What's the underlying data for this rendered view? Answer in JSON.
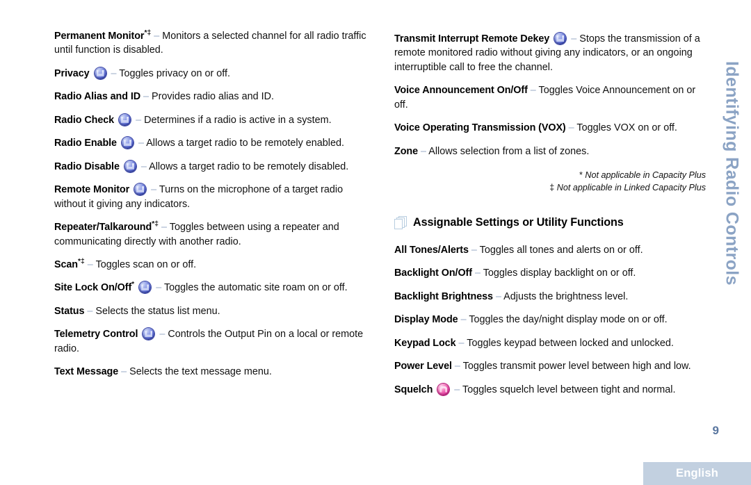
{
  "side_tab": {
    "label": "Identifying Radio Controls"
  },
  "page_number": "9",
  "footer": {
    "language": "English"
  },
  "dash": "–",
  "left_column": {
    "entries": [
      {
        "term": "Permanent Monitor",
        "marks": "*‡",
        "icon": null,
        "desc": "Monitors a selected channel for all radio traffic until function is disabled."
      },
      {
        "term": "Privacy",
        "marks": "",
        "icon": "blue-round-button-icon",
        "desc": "Toggles privacy on or off."
      },
      {
        "term": "Radio Alias and ID",
        "marks": "",
        "icon": null,
        "desc": "Provides radio alias and ID."
      },
      {
        "term": "Radio Check",
        "marks": "",
        "icon": "blue-round-button-icon",
        "desc": "Determines if a radio is active in a system."
      },
      {
        "term": "Radio Enable",
        "marks": "",
        "icon": "blue-round-button-icon",
        "desc": "Allows a target radio to be remotely enabled."
      },
      {
        "term": "Radio Disable",
        "marks": "",
        "icon": "blue-round-button-icon",
        "desc": "Allows a target radio to be remotely disabled."
      },
      {
        "term": "Remote Monitor",
        "marks": "",
        "icon": "blue-round-button-icon",
        "desc": "Turns on the microphone of a target radio without it giving any indicators."
      },
      {
        "term": "Repeater/Talkaround",
        "marks": "*‡",
        "icon": null,
        "desc": "Toggles between using a repeater and communicating directly with another radio."
      },
      {
        "term": "Scan",
        "marks": "*‡",
        "icon": null,
        "desc": "Toggles scan on or off."
      },
      {
        "term": "Site Lock On/Off",
        "marks": "*",
        "icon": "blue-round-button-icon",
        "desc": "Toggles the automatic site roam on or off."
      },
      {
        "term": "Status",
        "marks": "",
        "icon": null,
        "desc": "Selects the status list menu."
      },
      {
        "term": "Telemetry Control",
        "marks": "",
        "icon": "blue-round-button-icon",
        "desc": "Controls the Output Pin on a local or remote radio."
      },
      {
        "term": "Text Message",
        "marks": "",
        "icon": null,
        "desc": "Selects the text message menu."
      }
    ]
  },
  "right_column": {
    "entries_top": [
      {
        "term": "Transmit Interrupt Remote Dekey",
        "marks": "",
        "icon": "blue-round-button-icon",
        "desc": "Stops the transmission of a remote monitored radio without giving any indicators, or an ongoing interruptible call to free the channel."
      },
      {
        "term": "Voice Announcement On/Off",
        "marks": "",
        "icon": null,
        "desc": "Toggles Voice Announcement on or off."
      },
      {
        "term": "Voice Operating Transmission (VOX)",
        "marks": "",
        "icon": null,
        "desc": "Toggles VOX on or off."
      },
      {
        "term": "Zone",
        "marks": "",
        "icon": null,
        "desc": "Allows selection from a list of zones."
      }
    ],
    "footnotes": [
      {
        "mark": "*",
        "text": "Not applicable in Capacity Plus"
      },
      {
        "mark": "‡",
        "text": "Not applicable in Linked Capacity Plus"
      }
    ],
    "section": {
      "icon": "stacked-pages-icon",
      "title": "Assignable Settings or Utility Functions"
    },
    "entries_bottom": [
      {
        "term": "All Tones/Alerts",
        "marks": "",
        "icon": null,
        "desc": "Toggles all tones and alerts on or off."
      },
      {
        "term": "Backlight On/Off",
        "marks": "",
        "icon": null,
        "desc": "Toggles display backlight on or off."
      },
      {
        "term": "Backlight Brightness",
        "marks": "",
        "icon": null,
        "desc": "Adjusts the brightness level."
      },
      {
        "term": "Display Mode",
        "marks": "",
        "icon": null,
        "desc": "Toggles the day/night display mode on or off."
      },
      {
        "term": "Keypad Lock",
        "marks": "",
        "icon": null,
        "desc": "Toggles keypad between locked and unlocked."
      },
      {
        "term": "Power Level",
        "marks": "",
        "icon": null,
        "desc": "Toggles transmit power level between high and low."
      },
      {
        "term": "Squelch",
        "marks": "",
        "icon": "pink-round-button-icon",
        "desc": "Toggles squelch level between tight and normal."
      }
    ]
  }
}
